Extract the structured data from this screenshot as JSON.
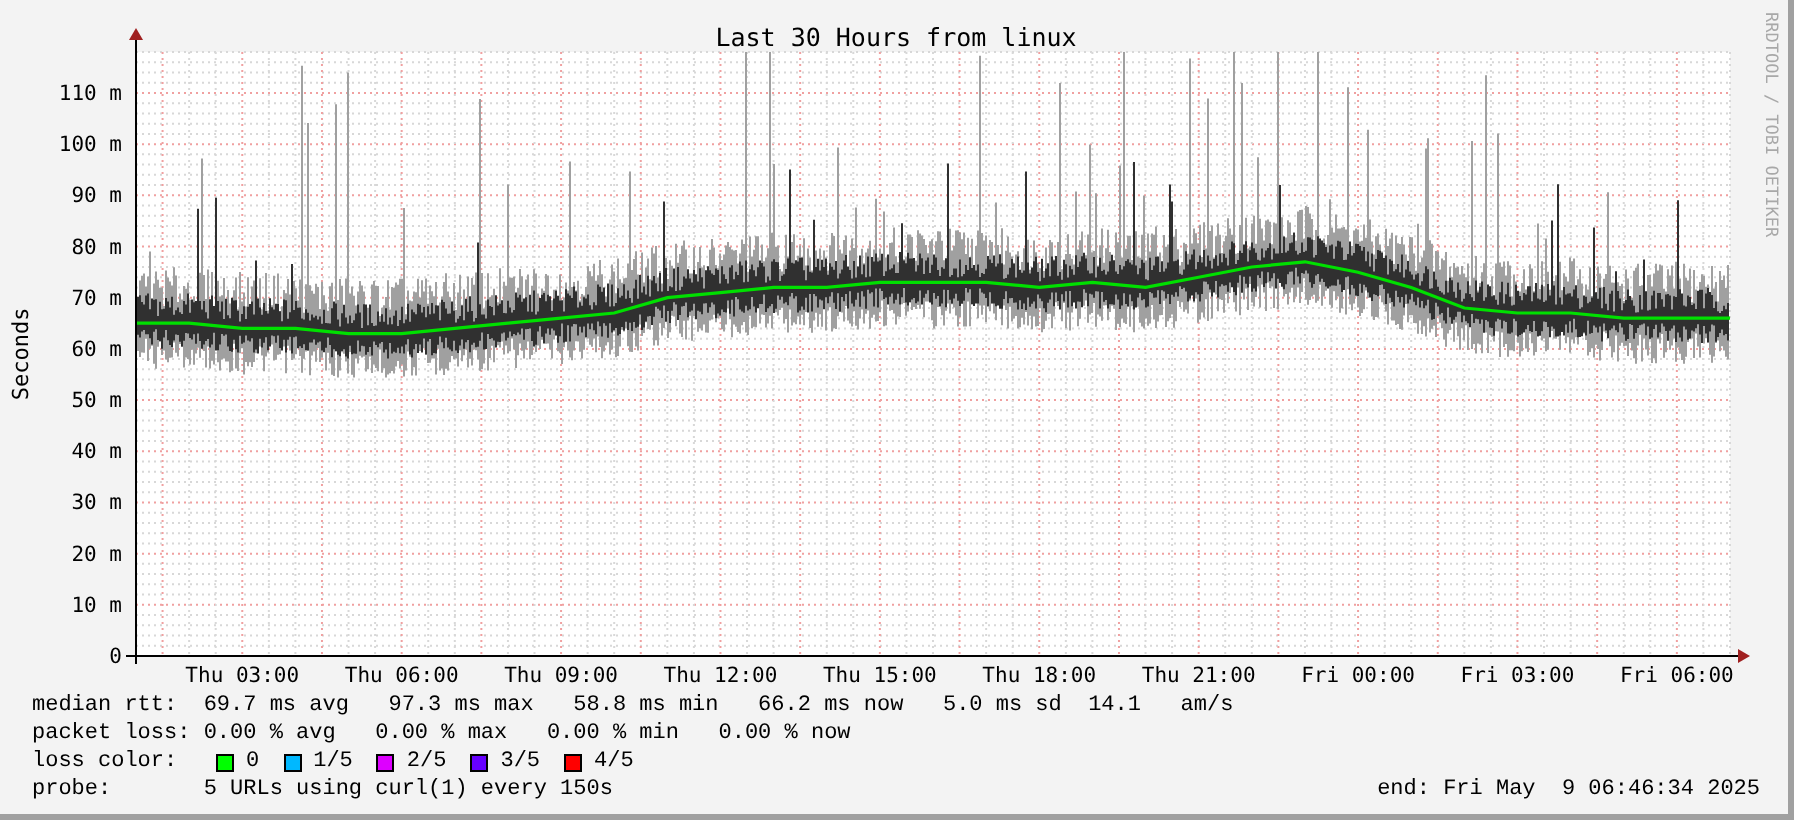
{
  "graph": {
    "side_text": "RRDTOOL / TOBI OETIKER",
    "chart_data": {
      "type": "line",
      "grid": true,
      "title": "Last 30 Hours from linux",
      "ylabel": "Seconds",
      "ylim": [
        0,
        118
      ],
      "categories": [
        null,
        null,
        "Thu 03:00",
        null,
        null,
        "Thu 06:00",
        null,
        null,
        "Thu 09:00",
        null,
        null,
        "Thu 12:00",
        null,
        null,
        "Thu 15:00",
        null,
        null,
        "Thu 18:00",
        null,
        null,
        "Thu 21:00",
        null,
        null,
        "Fri 00:00",
        null,
        null,
        "Fri 03:00",
        null,
        null,
        "Fri 06:00",
        null
      ],
      "series": [
        {
          "color": "#00e000",
          "values": [
            65,
            65,
            64,
            64,
            63,
            63,
            64,
            65,
            66,
            67,
            70,
            71,
            72,
            72,
            73,
            73,
            73,
            72,
            73,
            72,
            74,
            76,
            77,
            75,
            72,
            68,
            67,
            67,
            66,
            66,
            66
          ]
        }
      ],
      "yticks": [
        {
          "value": 0,
          "label": "0"
        },
        {
          "value": 10,
          "label": "10 m"
        },
        {
          "value": 20,
          "label": "20 m"
        },
        {
          "value": 30,
          "label": "30 m"
        },
        {
          "value": 40,
          "label": "40 m"
        },
        {
          "value": 50,
          "label": "50 m"
        },
        {
          "value": 60,
          "label": "60 m"
        },
        {
          "value": 70,
          "label": "70 m"
        },
        {
          "value": 80,
          "label": "80 m"
        },
        {
          "value": 90,
          "label": "90 m"
        },
        {
          "value": 100,
          "label": "100 m"
        },
        {
          "value": 110,
          "label": "110 m"
        }
      ]
    }
  },
  "legend": {
    "median_rtt": "median rtt:  69.7 ms avg   97.3 ms max   58.8 ms min   66.2 ms now   5.0 ms sd  14.1   am/s",
    "packet_loss": "packet loss: 0.00 % avg   0.00 % max   0.00 % min   0.00 % now",
    "loss_color_label": "loss color:",
    "loss_colors": [
      {
        "label": "0",
        "color": "#00ff00"
      },
      {
        "label": "1/5",
        "color": "#00b8ff"
      },
      {
        "label": "2/5",
        "color": "#dd00ff"
      },
      {
        "label": "3/5",
        "color": "#6600ff"
      },
      {
        "label": "4/5",
        "color": "#ff0000"
      }
    ],
    "probe": "probe:       5 URLs using curl(1) every 150s",
    "end": "end: Fri May  9 06:46:34 2025"
  }
}
